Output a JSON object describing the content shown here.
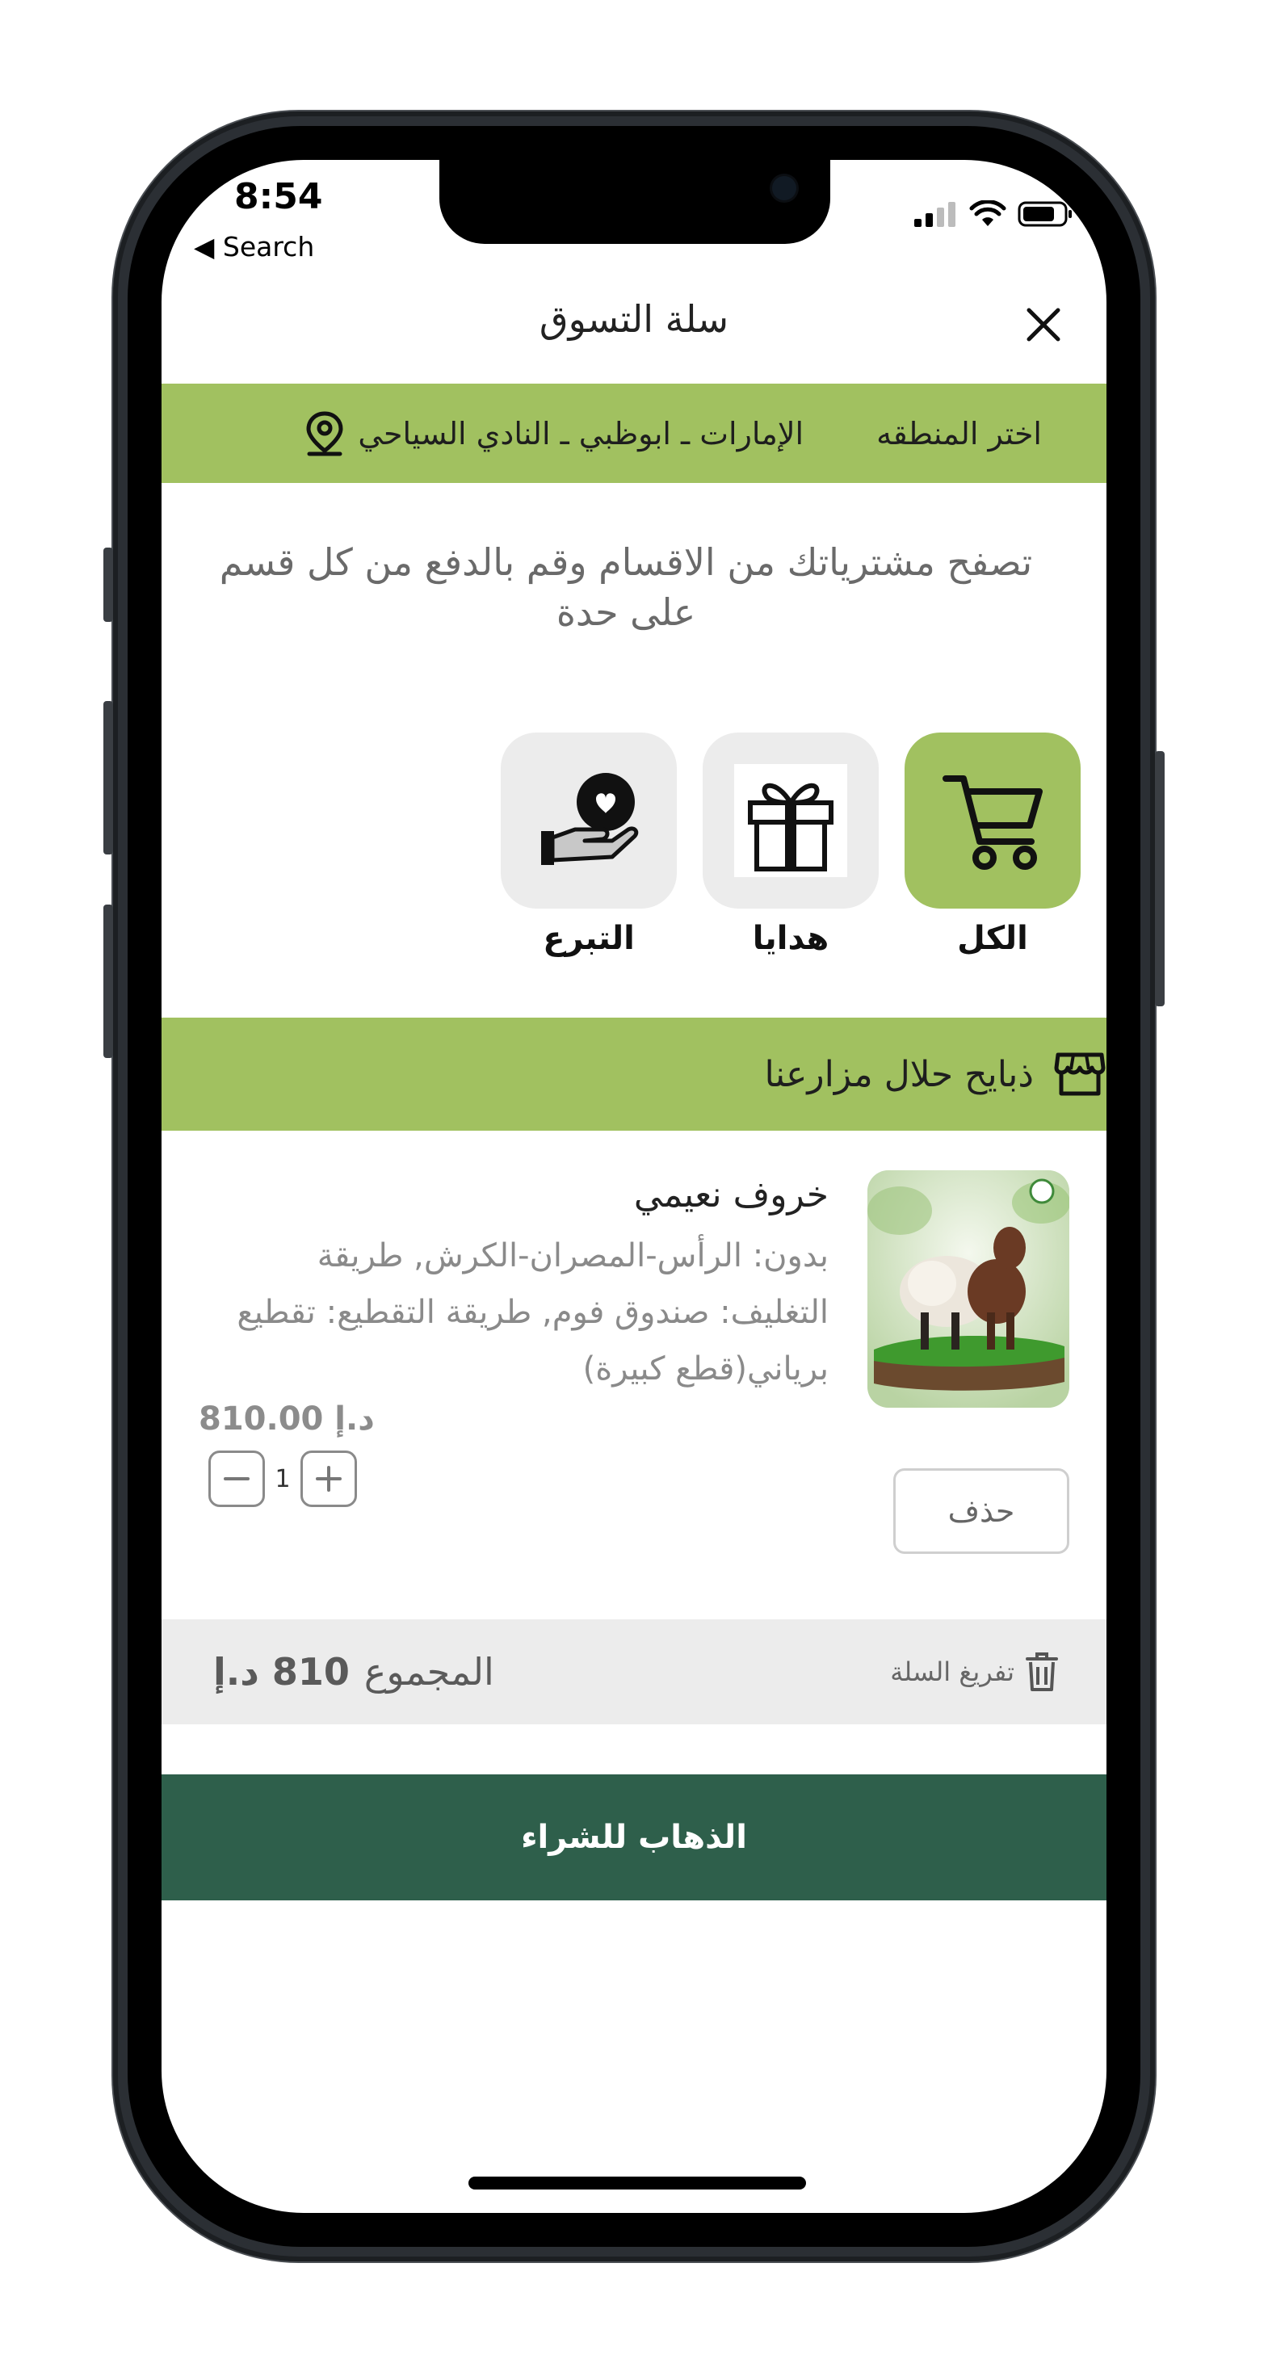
{
  "status_bar": {
    "time": "8:54",
    "back_label": "◀ Search"
  },
  "sheet": {
    "title": "سلة التسوق",
    "close_icon": "close-icon"
  },
  "region": {
    "choose_label": "اختر المنطقه",
    "location": "الإمارات ـ ابوظبي ـ النادي السياحي",
    "icon": "location-pin-icon",
    "color": "#a1c160"
  },
  "intro_text": "تصفح مشترياتك من الاقسام وقم بالدفع من كل قسم على حدة",
  "categories": [
    {
      "label": "الكل",
      "icon": "cart-icon",
      "active": true
    },
    {
      "label": "هدايا",
      "icon": "gift-icon",
      "active": false
    },
    {
      "label": "التبرع",
      "icon": "donate-icon",
      "active": false
    }
  ],
  "store": {
    "name": "ذبايح حلال مزارعنا",
    "icon": "store-icon"
  },
  "cart_item": {
    "name": "خروف نعيمي",
    "description": "بدون: الرأس-المصران-الكرش, طريقة التغليف: صندوق فوم, طريقة التقطيع: تقطيع برياني(قطع كبيرة)",
    "price": "810.00 د.إ",
    "quantity": "1",
    "delete_label": "حذف"
  },
  "totals": {
    "label": "المجموع",
    "amount": "810 د.إ",
    "clear_label": "تفريغ السلة"
  },
  "checkout_label": "الذهاب للشراء",
  "colors": {
    "accent_green": "#a1c160",
    "checkout_green": "#2e5f4b"
  }
}
